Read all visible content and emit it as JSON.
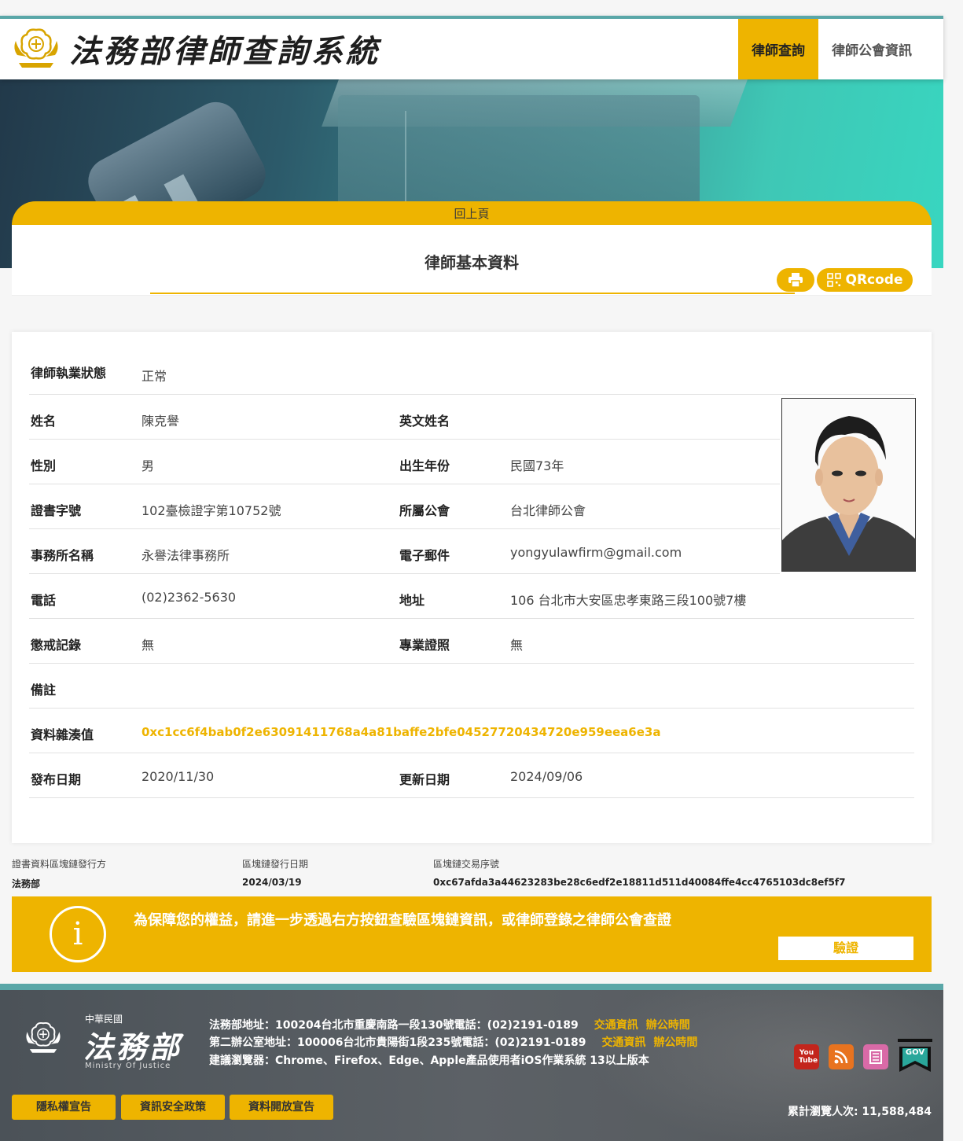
{
  "header": {
    "site_title": "法務部律師查詢系統",
    "nav": [
      {
        "label": "律師查詢",
        "active": true
      },
      {
        "label": "律師公會資訊",
        "active": false
      }
    ]
  },
  "card": {
    "back_label": "回上頁",
    "title": "律師基本資料",
    "print_icon": "printer-icon",
    "qr_label": "QRcode"
  },
  "profile": {
    "status_label": "律師執業狀態",
    "status": "正常",
    "name_label": "姓名",
    "name": "陳克譽",
    "en_name_label": "英文姓名",
    "en_name": "",
    "gender_label": "性別",
    "gender": "男",
    "birth_label": "出生年份",
    "birth": "民國73年",
    "cert_label": "證書字號",
    "cert": "102臺檢證字第10752號",
    "bar_label": "所屬公會",
    "bar": "台北律師公會",
    "firm_label": "事務所名稱",
    "firm": "永譽法律事務所",
    "email_label": "電子郵件",
    "email": "yongyulawfirm@gmail.com",
    "phone_label": "電話",
    "phone": "(02)2362-5630",
    "address_label": "地址",
    "address": "106 台北市大安區忠孝東路三段100號7樓",
    "discipline_label": "懲戒記錄",
    "discipline": "無",
    "specialty_label": "專業證照",
    "specialty": "無",
    "remark_label": "備註",
    "remark": "",
    "hash_label": "資料雜湊值",
    "hash": "0xc1cc6f4bab0f2e63091411768a4a81baffe2bfe04527720434720e959eea6e3a",
    "publish_label": "發布日期",
    "publish": "2020/11/30",
    "update_label": "更新日期",
    "update": "2024/09/06"
  },
  "chain": {
    "issuer_label": "證書資料區塊鏈發行方",
    "issuer": "法務部",
    "date_label": "區塊鏈發行日期",
    "date": "2024/03/19",
    "tx_label": "區塊鏈交易序號",
    "tx": "0xc67afda3a44623283be28c6edf2e18811d511d40084ffe4cc4765103dc8ef5f7"
  },
  "verify": {
    "message": "為保障您的權益，請進一步透過右方按鈕查驗區塊鏈資訊，或律師登錄之律師公會查證",
    "button": "驗證"
  },
  "footer": {
    "roc": "中華民國",
    "ministry_zh": "法務部",
    "ministry_en": "Ministry Of Justice",
    "line1": "法務部地址：100204台北市重慶南路一段130號電話：(02)2191-0189",
    "line2": "第二辦公室地址：100006台北市貴陽街1段235號電話：(02)2191-0189",
    "line3": "建議瀏覽器：Chrome、Firefox、Edge、Apple產品使用者iOS作業系統 13以上版本",
    "traffic": "交通資訊",
    "hours": "辦公時間",
    "buttons": [
      "隱私權宣告",
      "資訊安全政策",
      "資料開放宣告"
    ],
    "counter": "累計瀏覽人次: 11,588,484",
    "youtube_text": "You Tube",
    "gov_text": "GOV",
    "social_icons": [
      "youtube-icon",
      "rss-icon",
      "news-icon",
      "gov-icon"
    ]
  },
  "colors": {
    "accent": "#eeb400",
    "teal": "#5aa7a8",
    "footer_bg": "#54595e"
  }
}
